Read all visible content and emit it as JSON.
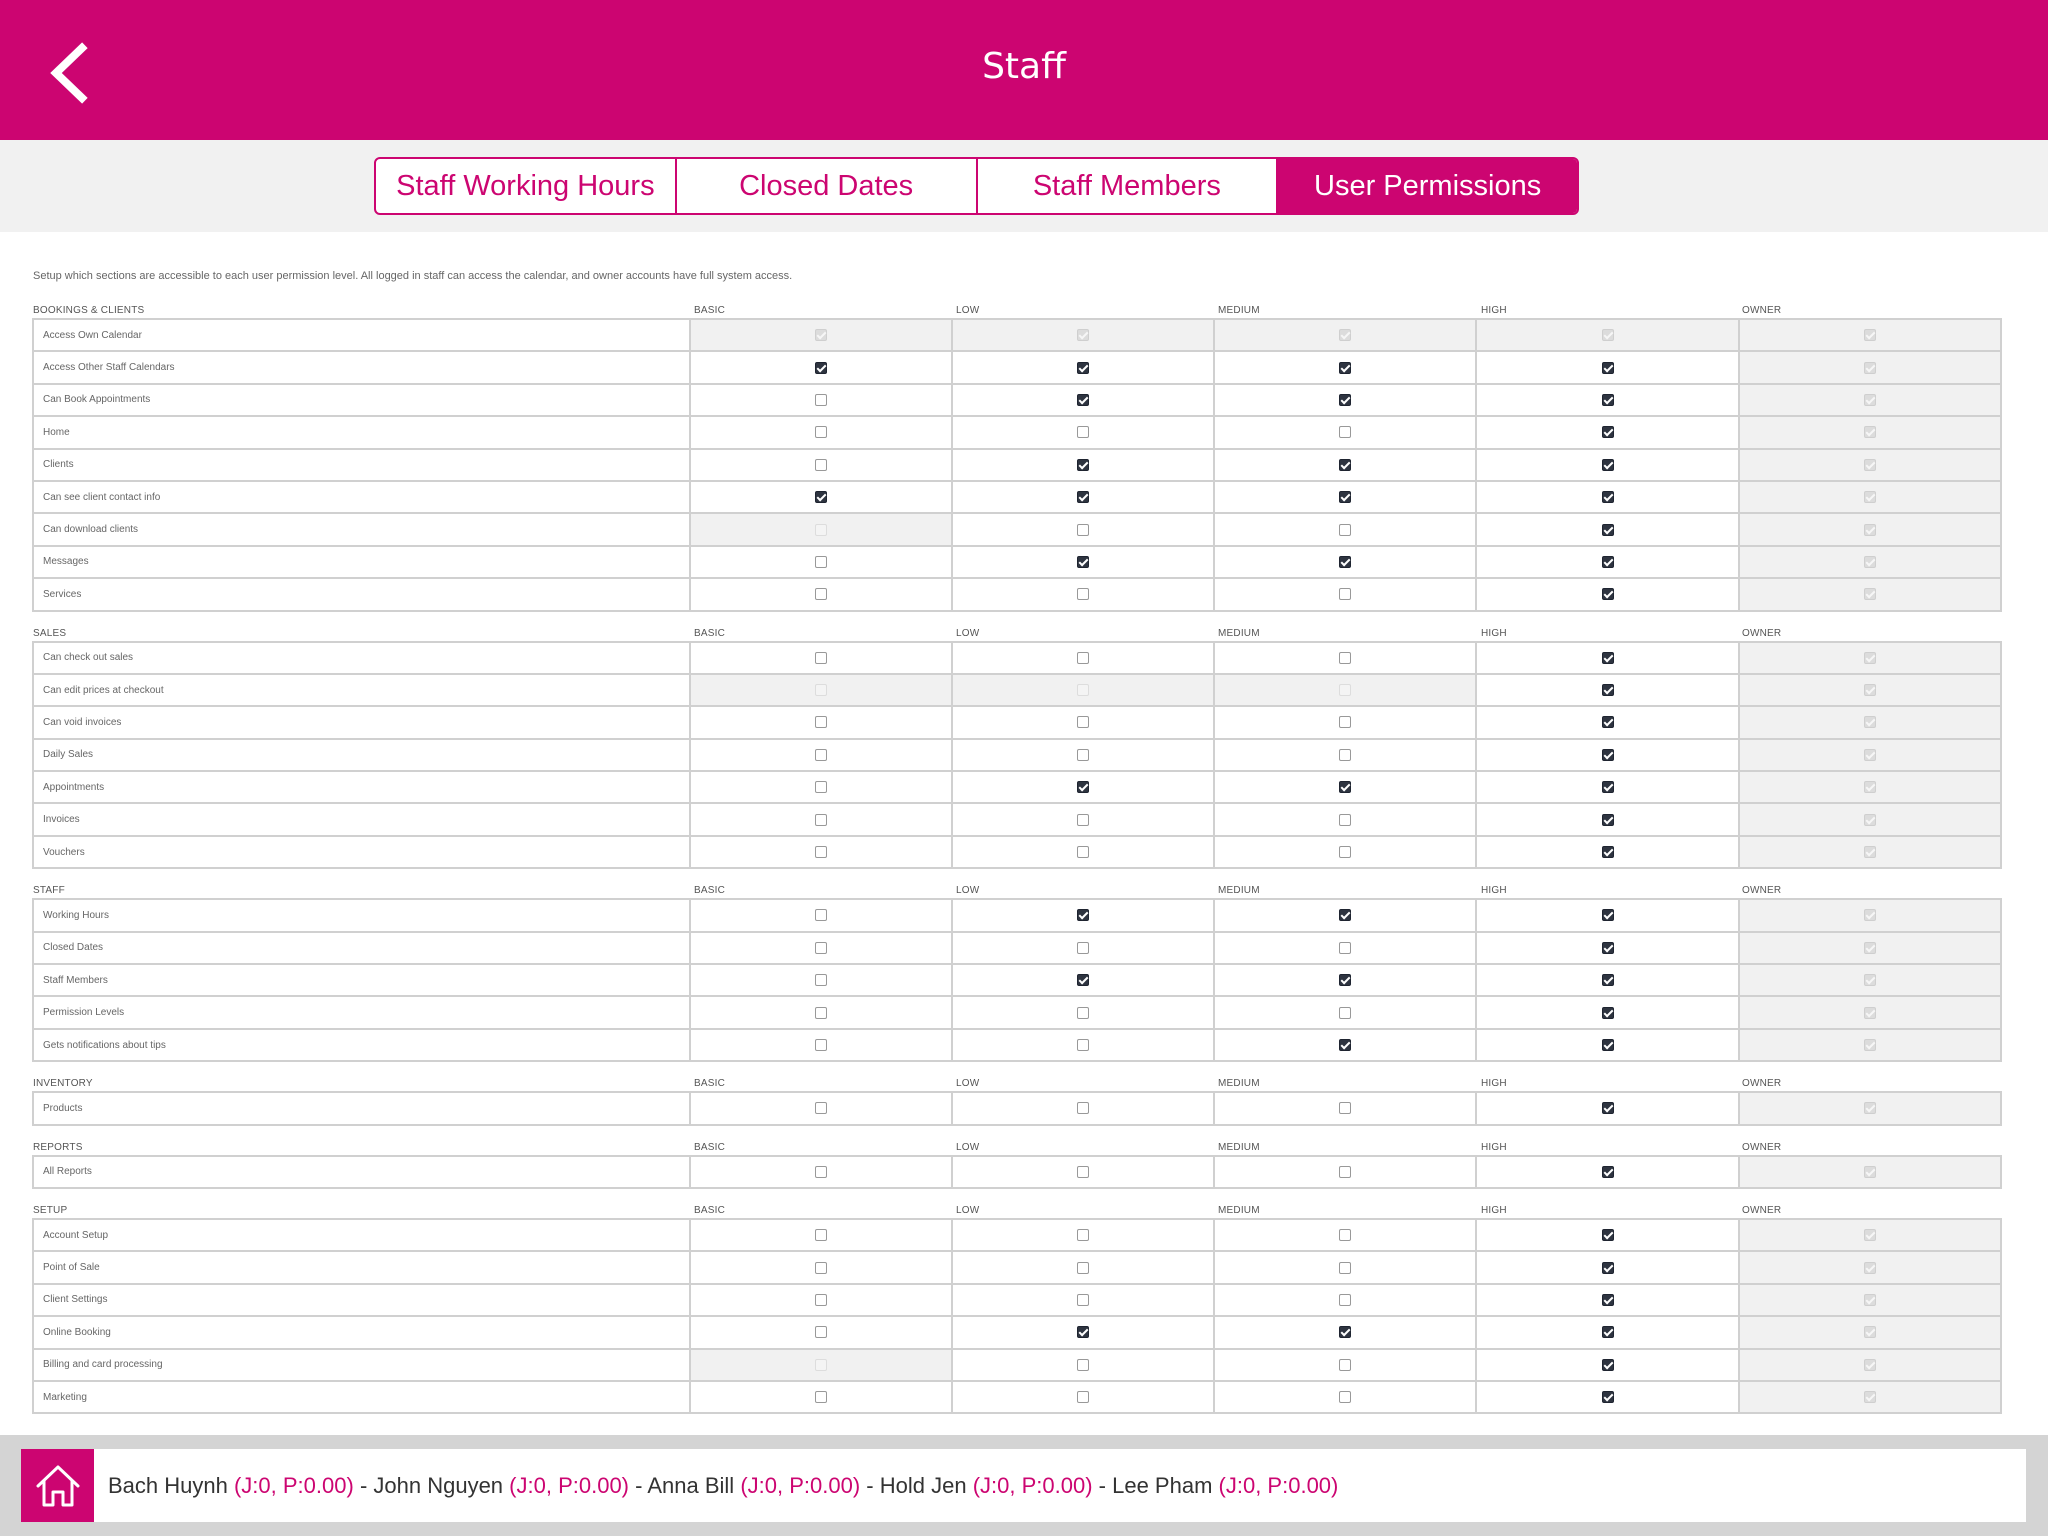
{
  "app": {
    "title": "Staff"
  },
  "tabs": [
    {
      "label": "Staff Working Hours",
      "active": false
    },
    {
      "label": "Closed Dates",
      "active": false
    },
    {
      "label": "Staff Members",
      "active": false
    },
    {
      "label": "User Permissions",
      "active": true
    }
  ],
  "intro": "Setup which sections are accessible to each user permission level. All logged in staff can access the calendar, and owner accounts have full system access.",
  "levels": [
    "BASIC",
    "LOW",
    "MEDIUM",
    "HIGH",
    "OWNER"
  ],
  "states_legend": {
    "on": "checked",
    "off": "unchecked",
    "dis": "disabled-unchecked",
    "dchk": "disabled-checked"
  },
  "sections": [
    {
      "title": "BOOKINGS & CLIENTS",
      "rows": [
        {
          "label": "Access Own Calendar",
          "states": [
            "dchk",
            "dchk",
            "dchk",
            "dchk",
            "dchk"
          ]
        },
        {
          "label": "Access Other Staff Calendars",
          "states": [
            "on",
            "on",
            "on",
            "on",
            "dchk"
          ]
        },
        {
          "label": "Can Book Appointments",
          "states": [
            "off",
            "on",
            "on",
            "on",
            "dchk"
          ]
        },
        {
          "label": "Home",
          "states": [
            "off",
            "off",
            "off",
            "on",
            "dchk"
          ]
        },
        {
          "label": "Clients",
          "states": [
            "off",
            "on",
            "on",
            "on",
            "dchk"
          ]
        },
        {
          "label": "Can see client contact info",
          "states": [
            "on",
            "on",
            "on",
            "on",
            "dchk"
          ]
        },
        {
          "label": "Can download clients",
          "states": [
            "dis",
            "off",
            "off",
            "on",
            "dchk"
          ]
        },
        {
          "label": "Messages",
          "states": [
            "off",
            "on",
            "on",
            "on",
            "dchk"
          ]
        },
        {
          "label": "Services",
          "states": [
            "off",
            "off",
            "off",
            "on",
            "dchk"
          ]
        }
      ]
    },
    {
      "title": "SALES",
      "rows": [
        {
          "label": "Can check out sales",
          "states": [
            "off",
            "off",
            "off",
            "on",
            "dchk"
          ]
        },
        {
          "label": "Can edit prices at checkout",
          "states": [
            "dis",
            "dis",
            "dis",
            "on",
            "dchk"
          ]
        },
        {
          "label": "Can void invoices",
          "states": [
            "off",
            "off",
            "off",
            "on",
            "dchk"
          ]
        },
        {
          "label": "Daily Sales",
          "states": [
            "off",
            "off",
            "off",
            "on",
            "dchk"
          ]
        },
        {
          "label": "Appointments",
          "states": [
            "off",
            "on",
            "on",
            "on",
            "dchk"
          ]
        },
        {
          "label": "Invoices",
          "states": [
            "off",
            "off",
            "off",
            "on",
            "dchk"
          ]
        },
        {
          "label": "Vouchers",
          "states": [
            "off",
            "off",
            "off",
            "on",
            "dchk"
          ]
        }
      ]
    },
    {
      "title": "STAFF",
      "rows": [
        {
          "label": "Working Hours",
          "states": [
            "off",
            "on",
            "on",
            "on",
            "dchk"
          ]
        },
        {
          "label": "Closed Dates",
          "states": [
            "off",
            "off",
            "off",
            "on",
            "dchk"
          ]
        },
        {
          "label": "Staff Members",
          "states": [
            "off",
            "on",
            "on",
            "on",
            "dchk"
          ]
        },
        {
          "label": "Permission Levels",
          "states": [
            "off",
            "off",
            "off",
            "on",
            "dchk"
          ]
        },
        {
          "label": "Gets notifications about tips",
          "states": [
            "off",
            "off",
            "on",
            "on",
            "dchk"
          ]
        }
      ]
    },
    {
      "title": "INVENTORY",
      "rows": [
        {
          "label": "Products",
          "states": [
            "off",
            "off",
            "off",
            "on",
            "dchk"
          ]
        }
      ]
    },
    {
      "title": "REPORTS",
      "rows": [
        {
          "label": "All Reports",
          "states": [
            "off",
            "off",
            "off",
            "on",
            "dchk"
          ]
        }
      ]
    },
    {
      "title": "SETUP",
      "rows": [
        {
          "label": "Account Setup",
          "states": [
            "off",
            "off",
            "off",
            "on",
            "dchk"
          ]
        },
        {
          "label": "Point of Sale",
          "states": [
            "off",
            "off",
            "off",
            "on",
            "dchk"
          ]
        },
        {
          "label": "Client Settings",
          "states": [
            "off",
            "off",
            "off",
            "on",
            "dchk"
          ]
        },
        {
          "label": "Online Booking",
          "states": [
            "off",
            "on",
            "on",
            "on",
            "dchk"
          ]
        },
        {
          "label": "Billing and card processing",
          "states": [
            "dis",
            "off",
            "off",
            "on",
            "dchk"
          ]
        },
        {
          "label": "Marketing",
          "states": [
            "off",
            "off",
            "off",
            "on",
            "dchk"
          ]
        }
      ]
    }
  ],
  "footer": {
    "staff": [
      {
        "name": "Bach Huynh",
        "stat": "(J:0, P:0.00)"
      },
      {
        "name": "John Nguyen",
        "stat": "(J:0, P:0.00)"
      },
      {
        "name": "Anna Bill",
        "stat": "(J:0, P:0.00)"
      },
      {
        "name": "Hold Jen",
        "stat": "(J:0, P:0.00)"
      },
      {
        "name": "Lee Pham",
        "stat": "(J:0, P:0.00)"
      }
    ],
    "separator": " - "
  },
  "icons": {
    "back": "chevron-left-icon",
    "home": "home-icon"
  },
  "colors": {
    "brand": "#cc0571",
    "tabbar_bg": "#f1f1f1",
    "footer_bg": "#d4d4d4",
    "checked": "#2e3440",
    "owner_column_bg": "#f1f1f1"
  }
}
